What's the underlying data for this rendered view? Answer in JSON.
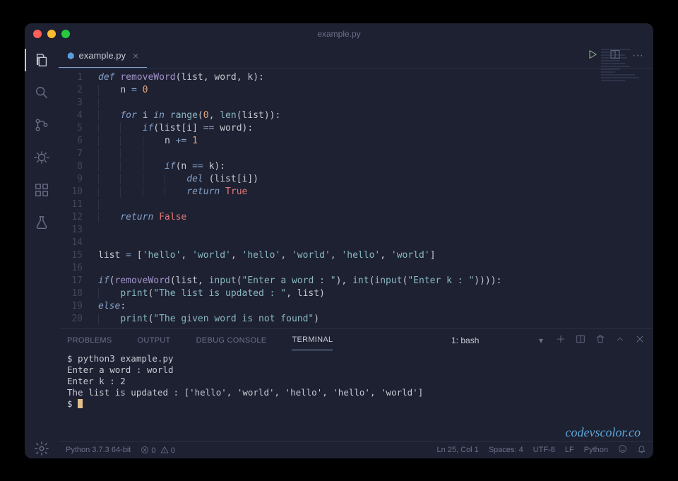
{
  "window": {
    "title": "example.py"
  },
  "tab": {
    "label": "example.py",
    "fileicon": "python"
  },
  "actions": {
    "run": "▷",
    "split": "▯▯",
    "more": "···"
  },
  "activity_icons": [
    "files",
    "search",
    "source-control",
    "debug",
    "extensions",
    "beaker",
    "settings"
  ],
  "code": {
    "lines": [
      [
        {
          "t": "def ",
          "c": "k"
        },
        {
          "t": "removeWord",
          "c": "fn"
        },
        {
          "t": "(",
          "c": "p"
        },
        {
          "t": "list",
          "c": "pn"
        },
        {
          "t": ", ",
          "c": "p"
        },
        {
          "t": "word",
          "c": "pn"
        },
        {
          "t": ", ",
          "c": "p"
        },
        {
          "t": "k",
          "c": "pn"
        },
        {
          "t": "):",
          "c": "p"
        }
      ],
      [
        {
          "indent": 1
        },
        {
          "t": "n ",
          "c": "pn"
        },
        {
          "t": "= ",
          "c": "op"
        },
        {
          "t": "0",
          "c": "n"
        }
      ],
      [
        {
          "indent": 1
        }
      ],
      [
        {
          "indent": 1
        },
        {
          "t": "for ",
          "c": "k"
        },
        {
          "t": "i ",
          "c": "pn"
        },
        {
          "t": "in ",
          "c": "k"
        },
        {
          "t": "range",
          "c": "bi"
        },
        {
          "t": "(",
          "c": "p"
        },
        {
          "t": "0",
          "c": "n"
        },
        {
          "t": ", ",
          "c": "p"
        },
        {
          "t": "len",
          "c": "bi"
        },
        {
          "t": "(",
          "c": "p"
        },
        {
          "t": "list",
          "c": "pn"
        },
        {
          "t": ")):",
          "c": "p"
        }
      ],
      [
        {
          "indent": 2
        },
        {
          "t": "if",
          "c": "k"
        },
        {
          "t": "(",
          "c": "p"
        },
        {
          "t": "list",
          "c": "pn"
        },
        {
          "t": "[",
          "c": "p"
        },
        {
          "t": "i",
          "c": "pn"
        },
        {
          "t": "] ",
          "c": "p"
        },
        {
          "t": "== ",
          "c": "op"
        },
        {
          "t": "word",
          "c": "pn"
        },
        {
          "t": "):",
          "c": "p"
        }
      ],
      [
        {
          "indent": 3
        },
        {
          "t": "n ",
          "c": "pn"
        },
        {
          "t": "+= ",
          "c": "op"
        },
        {
          "t": "1",
          "c": "n"
        }
      ],
      [
        {
          "indent": 3
        }
      ],
      [
        {
          "indent": 3
        },
        {
          "t": "if",
          "c": "k"
        },
        {
          "t": "(",
          "c": "p"
        },
        {
          "t": "n ",
          "c": "pn"
        },
        {
          "t": "== ",
          "c": "op"
        },
        {
          "t": "k",
          "c": "pn"
        },
        {
          "t": "):",
          "c": "p"
        }
      ],
      [
        {
          "indent": 4
        },
        {
          "t": "del ",
          "c": "k"
        },
        {
          "t": "(",
          "c": "p"
        },
        {
          "t": "list",
          "c": "pn"
        },
        {
          "t": "[",
          "c": "p"
        },
        {
          "t": "i",
          "c": "pn"
        },
        {
          "t": "])",
          "c": "p"
        }
      ],
      [
        {
          "indent": 4
        },
        {
          "t": "return ",
          "c": "k"
        },
        {
          "t": "True",
          "c": "b"
        }
      ],
      [
        {
          "indent": 1
        }
      ],
      [
        {
          "indent": 1
        },
        {
          "t": "return ",
          "c": "k"
        },
        {
          "t": "False",
          "c": "b"
        }
      ],
      [],
      [],
      [
        {
          "t": "list ",
          "c": "pn"
        },
        {
          "t": "= ",
          "c": "op"
        },
        {
          "t": "[",
          "c": "p"
        },
        {
          "t": "'hello'",
          "c": "s"
        },
        {
          "t": ", ",
          "c": "p"
        },
        {
          "t": "'world'",
          "c": "s"
        },
        {
          "t": ", ",
          "c": "p"
        },
        {
          "t": "'hello'",
          "c": "s"
        },
        {
          "t": ", ",
          "c": "p"
        },
        {
          "t": "'world'",
          "c": "s"
        },
        {
          "t": ", ",
          "c": "p"
        },
        {
          "t": "'hello'",
          "c": "s"
        },
        {
          "t": ", ",
          "c": "p"
        },
        {
          "t": "'world'",
          "c": "s"
        },
        {
          "t": "]",
          "c": "p"
        }
      ],
      [],
      [
        {
          "t": "if",
          "c": "k"
        },
        {
          "t": "(",
          "c": "p"
        },
        {
          "t": "removeWord",
          "c": "fn"
        },
        {
          "t": "(",
          "c": "p"
        },
        {
          "t": "list",
          "c": "pn"
        },
        {
          "t": ", ",
          "c": "p"
        },
        {
          "t": "input",
          "c": "bi"
        },
        {
          "t": "(",
          "c": "p"
        },
        {
          "t": "\"Enter a word : \"",
          "c": "s"
        },
        {
          "t": "), ",
          "c": "p"
        },
        {
          "t": "int",
          "c": "bi"
        },
        {
          "t": "(",
          "c": "p"
        },
        {
          "t": "input",
          "c": "bi"
        },
        {
          "t": "(",
          "c": "p"
        },
        {
          "t": "\"Enter k : \"",
          "c": "s"
        },
        {
          "t": ")))):",
          "c": "p"
        }
      ],
      [
        {
          "indent": 1
        },
        {
          "t": "print",
          "c": "bi"
        },
        {
          "t": "(",
          "c": "p"
        },
        {
          "t": "\"The list is updated : \"",
          "c": "s"
        },
        {
          "t": ", ",
          "c": "p"
        },
        {
          "t": "list",
          "c": "pn"
        },
        {
          "t": ")",
          "c": "p"
        }
      ],
      [
        {
          "t": "else",
          "c": "k"
        },
        {
          "t": ":",
          "c": "p"
        }
      ],
      [
        {
          "indent": 1
        },
        {
          "t": "print",
          "c": "bi"
        },
        {
          "t": "(",
          "c": "p"
        },
        {
          "t": "\"The given word is not found\"",
          "c": "s"
        },
        {
          "t": ")",
          "c": "p"
        }
      ]
    ]
  },
  "panel": {
    "tabs": [
      "PROBLEMS",
      "OUTPUT",
      "DEBUG CONSOLE",
      "TERMINAL"
    ],
    "active": 3,
    "shell": "1: bash",
    "lines": [
      "$ python3 example.py",
      "Enter a word : world",
      "Enter k : 2",
      "The list is updated :  ['hello', 'world', 'hello', 'hello', 'world']",
      "$ "
    ]
  },
  "status": {
    "python": "Python 3.7.3 64-bit",
    "errors": "0",
    "warnings": "0",
    "cursor": "Ln 25, Col 1",
    "spaces": "Spaces: 4",
    "encoding": "UTF-8",
    "eol": "LF",
    "lang": "Python"
  },
  "watermark": "codevscolor.co"
}
